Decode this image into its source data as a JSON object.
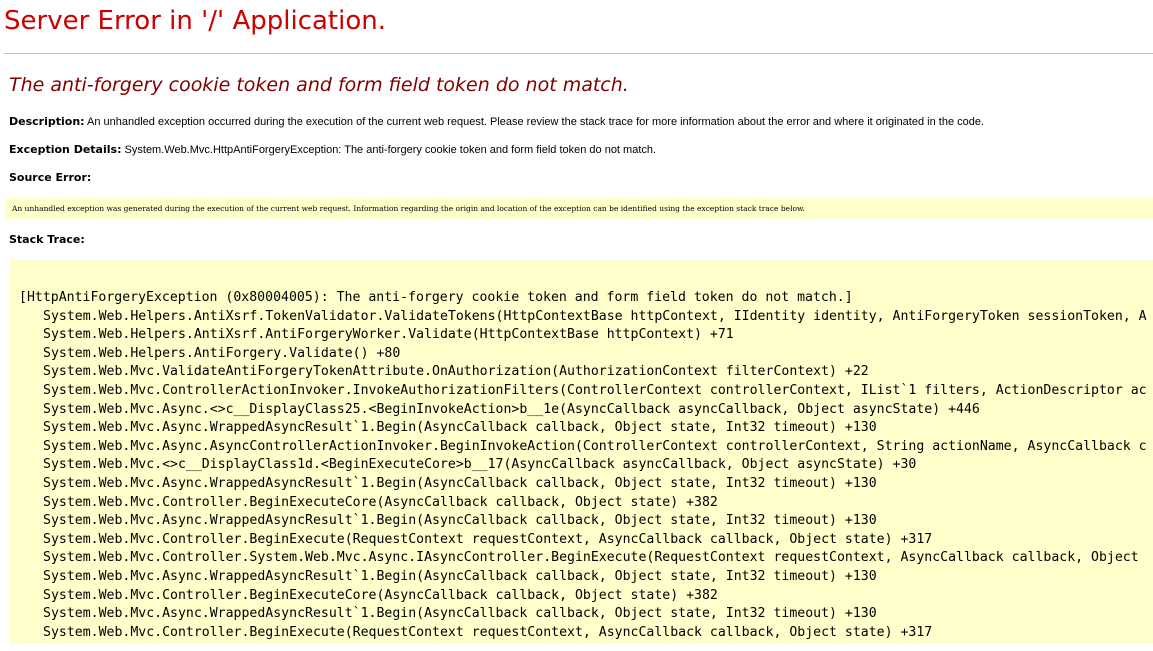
{
  "title": "Server Error in '/' Application.",
  "message": "The anti-forgery cookie token and form field token do not match.",
  "description": {
    "label": "Description:",
    "text": "An unhandled exception occurred during the execution of the current web request. Please review the stack trace for more information about the error and where it originated in the code."
  },
  "exception_details": {
    "label": "Exception Details:",
    "text": "System.Web.Mvc.HttpAntiForgeryException: The anti-forgery cookie token and form field token do not match."
  },
  "source_error": {
    "label": "Source Error:",
    "text": "An unhandled exception was generated during the execution of the current web request. Information regarding the origin and location of the exception can be identified using the exception stack trace below."
  },
  "stack_trace": {
    "label": "Stack Trace:",
    "header": "[HttpAntiForgeryException (0x80004005): The anti-forgery cookie token and form field token do not match.]",
    "frames": [
      "System.Web.Helpers.AntiXsrf.TokenValidator.ValidateTokens(HttpContextBase httpContext, IIdentity identity, AntiForgeryToken sessionToken, A",
      "System.Web.Helpers.AntiXsrf.AntiForgeryWorker.Validate(HttpContextBase httpContext) +71",
      "System.Web.Helpers.AntiForgery.Validate() +80",
      "System.Web.Mvc.ValidateAntiForgeryTokenAttribute.OnAuthorization(AuthorizationContext filterContext) +22",
      "System.Web.Mvc.ControllerActionInvoker.InvokeAuthorizationFilters(ControllerContext controllerContext, IList`1 filters, ActionDescriptor ac",
      "System.Web.Mvc.Async.<>c__DisplayClass25.<BeginInvokeAction>b__1e(AsyncCallback asyncCallback, Object asyncState) +446",
      "System.Web.Mvc.Async.WrappedAsyncResult`1.Begin(AsyncCallback callback, Object state, Int32 timeout) +130",
      "System.Web.Mvc.Async.AsyncControllerActionInvoker.BeginInvokeAction(ControllerContext controllerContext, String actionName, AsyncCallback c",
      "System.Web.Mvc.<>c__DisplayClass1d.<BeginExecuteCore>b__17(AsyncCallback asyncCallback, Object asyncState) +30",
      "System.Web.Mvc.Async.WrappedAsyncResult`1.Begin(AsyncCallback callback, Object state, Int32 timeout) +130",
      "System.Web.Mvc.Controller.BeginExecuteCore(AsyncCallback callback, Object state) +382",
      "System.Web.Mvc.Async.WrappedAsyncResult`1.Begin(AsyncCallback callback, Object state, Int32 timeout) +130",
      "System.Web.Mvc.Controller.BeginExecute(RequestContext requestContext, AsyncCallback callback, Object state) +317",
      "System.Web.Mvc.Controller.System.Web.Mvc.Async.IAsyncController.BeginExecute(RequestContext requestContext, AsyncCallback callback, Object",
      "System.Web.Mvc.Async.WrappedAsyncResult`1.Begin(AsyncCallback callback, Object state, Int32 timeout) +130",
      "System.Web.Mvc.Controller.BeginExecuteCore(AsyncCallback callback, Object state) +382",
      "System.Web.Mvc.Async.WrappedAsyncResult`1.Begin(AsyncCallback callback, Object state, Int32 timeout) +130",
      "System.Web.Mvc.Controller.BeginExecute(RequestContext requestContext, AsyncCallback callback, Object state) +317"
    ]
  },
  "colors": {
    "title": "#cc0000",
    "message": "#800000",
    "code_background": "#ffffcc",
    "rule": "#c0c0c0"
  }
}
